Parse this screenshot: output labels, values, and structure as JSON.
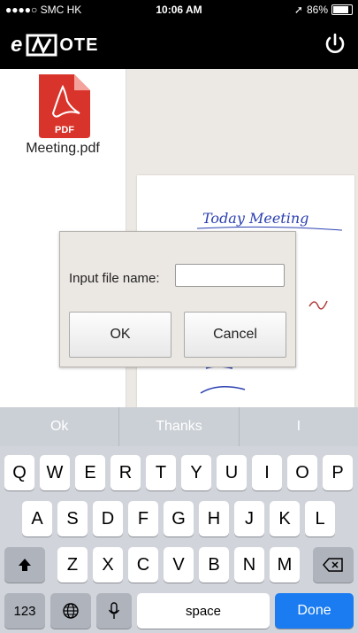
{
  "status_bar": {
    "carrier": "●●●●○ SMC HK",
    "time": "10:06 AM",
    "battery": "86%",
    "battery_level": 0.86
  },
  "app": {
    "logo_e": "e",
    "logo_rest": "OTE"
  },
  "sidebar": {
    "files": [
      {
        "name": "Meeting.pdf",
        "icon_label": "PDF"
      }
    ]
  },
  "document": {
    "handwriting": "Today Meeting"
  },
  "dialog": {
    "label": "Input file name:",
    "input_value": "",
    "input_placeholder": "",
    "ok_label": "OK",
    "cancel_label": "Cancel"
  },
  "suggestions": [
    "Ok",
    "Thanks",
    "I"
  ],
  "keyboard": {
    "row1": [
      "Q",
      "W",
      "E",
      "R",
      "T",
      "Y",
      "U",
      "I",
      "O",
      "P"
    ],
    "row2": [
      "A",
      "S",
      "D",
      "F",
      "G",
      "H",
      "J",
      "K",
      "L"
    ],
    "row3": [
      "Z",
      "X",
      "C",
      "V",
      "B",
      "N",
      "M"
    ],
    "numbers_label": "123",
    "space_label": "space",
    "done_label": "Done"
  },
  "colors": {
    "accent": "#1a7cf0",
    "pdf_red": "#d9342b",
    "ink": "#2a3fb0"
  }
}
